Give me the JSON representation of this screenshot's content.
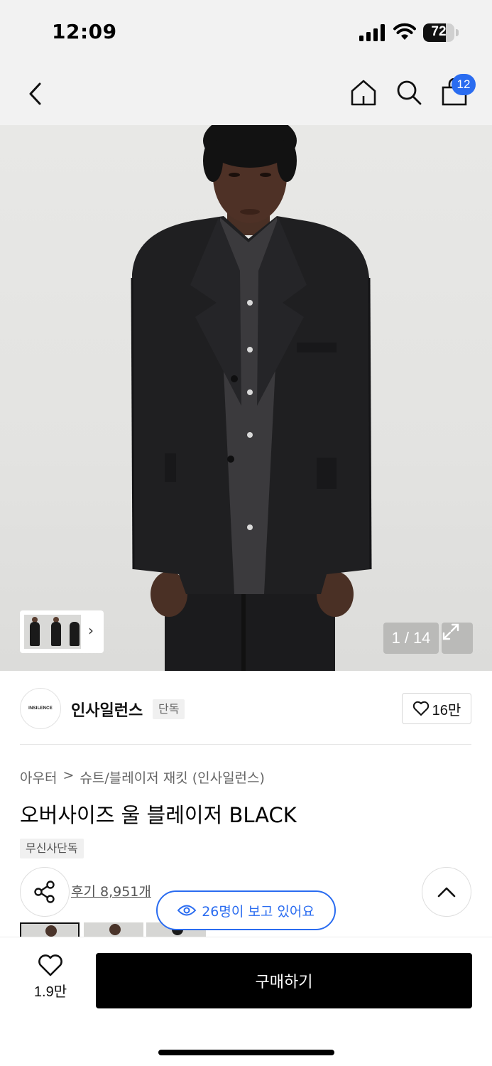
{
  "status_bar": {
    "time": "12:09",
    "battery_level": "72",
    "battery_fraction": 0.72
  },
  "nav": {
    "cart_count": "12"
  },
  "gallery": {
    "current_page": "1",
    "total_pages": "14",
    "separator": "/"
  },
  "brand": {
    "logo_text": "INSILENCE",
    "name": "인사일런스",
    "tag": "단독",
    "like_count": "16만"
  },
  "product": {
    "breadcrumb": [
      "아우터",
      "슈트/블레이저 재킷 (인사일런스)"
    ],
    "breadcrumb_separator": ">",
    "title": "오버사이즈 울 블레이저 BLACK",
    "exclusive_tag": "무신사단독",
    "review_link": "후기 8,951개",
    "viewers": "26명이 보고 있어요"
  },
  "bottom_bar": {
    "wish_count": "1.9만",
    "buy_label": "구매하기"
  },
  "colors": {
    "accent_blue": "#2a6cf0",
    "buy_button": "#000000",
    "nav_background": "#f2f2f2"
  },
  "icons": [
    "back-icon",
    "home-icon",
    "search-icon",
    "shopping-bag-icon",
    "expand-icon",
    "heart-icon",
    "share-icon",
    "eye-icon",
    "chevron-up-icon",
    "chevron-right-icon"
  ]
}
